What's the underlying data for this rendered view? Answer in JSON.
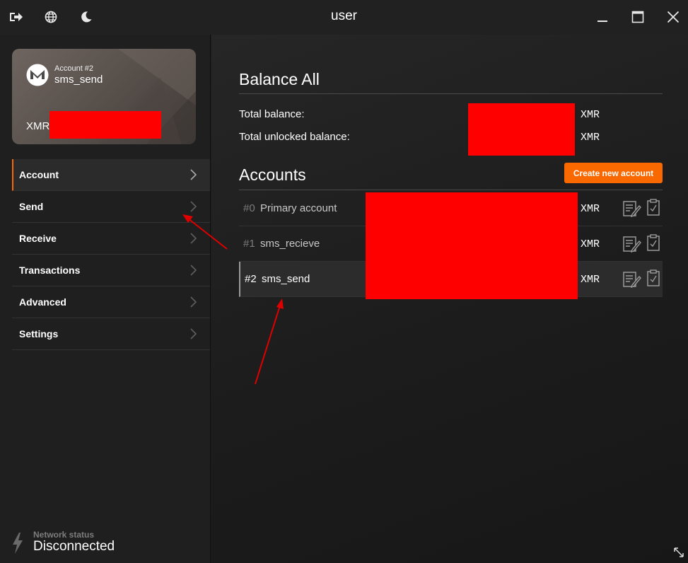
{
  "window": {
    "title": "user"
  },
  "account_card": {
    "label": "Account #2",
    "name": "sms_send",
    "currency": "XMR"
  },
  "nav": {
    "items": [
      {
        "label": "Account",
        "active": true
      },
      {
        "label": "Send",
        "active": false
      },
      {
        "label": "Receive",
        "active": false
      },
      {
        "label": "Transactions",
        "active": false
      },
      {
        "label": "Advanced",
        "active": false
      },
      {
        "label": "Settings",
        "active": false
      }
    ]
  },
  "network": {
    "label": "Network status",
    "value": "Disconnected"
  },
  "balance": {
    "heading": "Balance All",
    "total_label": "Total balance:",
    "total_currency": "XMR",
    "unlocked_label": "Total unlocked balance:",
    "unlocked_currency": "XMR"
  },
  "accounts": {
    "heading": "Accounts",
    "create_label": "Create new account",
    "rows": [
      {
        "index": "#0",
        "name": "Primary account",
        "currency": "XMR",
        "selected": false
      },
      {
        "index": "#1",
        "name": "sms_recieve",
        "currency": "XMR",
        "selected": false
      },
      {
        "index": "#2",
        "name": "sms_send",
        "currency": "XMR",
        "selected": true
      }
    ]
  },
  "icons": {
    "titlebar_left": [
      "logout-icon",
      "globe-icon",
      "moon-icon"
    ],
    "titlebar_right": [
      "minimize-icon",
      "maximize-icon",
      "close-icon"
    ],
    "row_actions": [
      "edit-label-icon",
      "copy-address-icon"
    ],
    "network": "lightning-icon"
  },
  "colors": {
    "accent": "#fa6800",
    "redaction": "#ff0000",
    "annotation_arrow": "#e00000"
  }
}
